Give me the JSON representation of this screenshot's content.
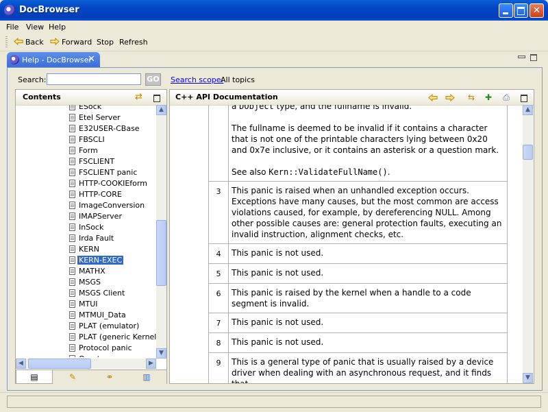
{
  "window": {
    "title": "DocBrowser",
    "accent": "#0a5fd8"
  },
  "menu": {
    "items": [
      "File",
      "View",
      "Help"
    ]
  },
  "toolbar": {
    "back": "Back",
    "forward": "Forward",
    "stop": "Stop",
    "refresh": "Refresh"
  },
  "view_tab": {
    "label": "Help - DocBrowser",
    "close": "✕"
  },
  "search": {
    "label": "Search:",
    "value": "",
    "go": "GO",
    "scope_link": "Search scope:",
    "scope_value": "All topics"
  },
  "contents": {
    "title": "Contents",
    "items": [
      "ESock",
      "Etel Server",
      "E32USER-CBase",
      "FBSCLI",
      "Form",
      "FSCLIENT",
      "FSCLIENT panic",
      "HTTP-COOKIEform",
      "HTTP-CORE",
      "ImageConversion",
      "IMAPServer",
      "InSock",
      "Irda Fault",
      "KERN",
      "KERN-EXEC",
      "MATHX",
      "MSGS",
      "MSGS Client",
      "MTUI",
      "MTMUI_Data",
      "PLAT (emulator)",
      "PLAT (generic Kernel)",
      "Protocol panic",
      "Quartz"
    ],
    "selected": "KERN-EXEC"
  },
  "doc": {
    "title": "C++ API Documentation",
    "cont_text_a": "a ",
    "cont_code": "DObject",
    "cont_text_b": " type, and the fullname is invalid.",
    "para2": "The fullname is deemed to be invalid if it contains a character that is not one of the printable characters lying between 0x20 and 0x7e inclusive, or it contains an asterisk or a question mark.",
    "see_also": "See also ",
    "see_also_code": "Kern::ValidateFullName()",
    "see_also_end": ".",
    "rows": [
      {
        "num": "3",
        "text": "This panic is raised when an unhandled exception occurs. Exceptions have many causes, but the most common are access violations caused, for example, by dereferencing NULL. Among other possible causes are: general protection faults, executing an invalid instruction, alignment checks, etc."
      },
      {
        "num": "4",
        "text": "This panic is not used."
      },
      {
        "num": "5",
        "text": "This panic is not used."
      },
      {
        "num": "6",
        "text": "This panic is raised by the kernel when a handle to a code segment is invalid."
      },
      {
        "num": "7",
        "text": "This panic is not used."
      },
      {
        "num": "8",
        "text": "This panic is not used."
      },
      {
        "num": "9",
        "text": "This is a general type of panic that is usually raised by a device driver when dealing with an asynchronous request, and it finds that"
      }
    ]
  }
}
